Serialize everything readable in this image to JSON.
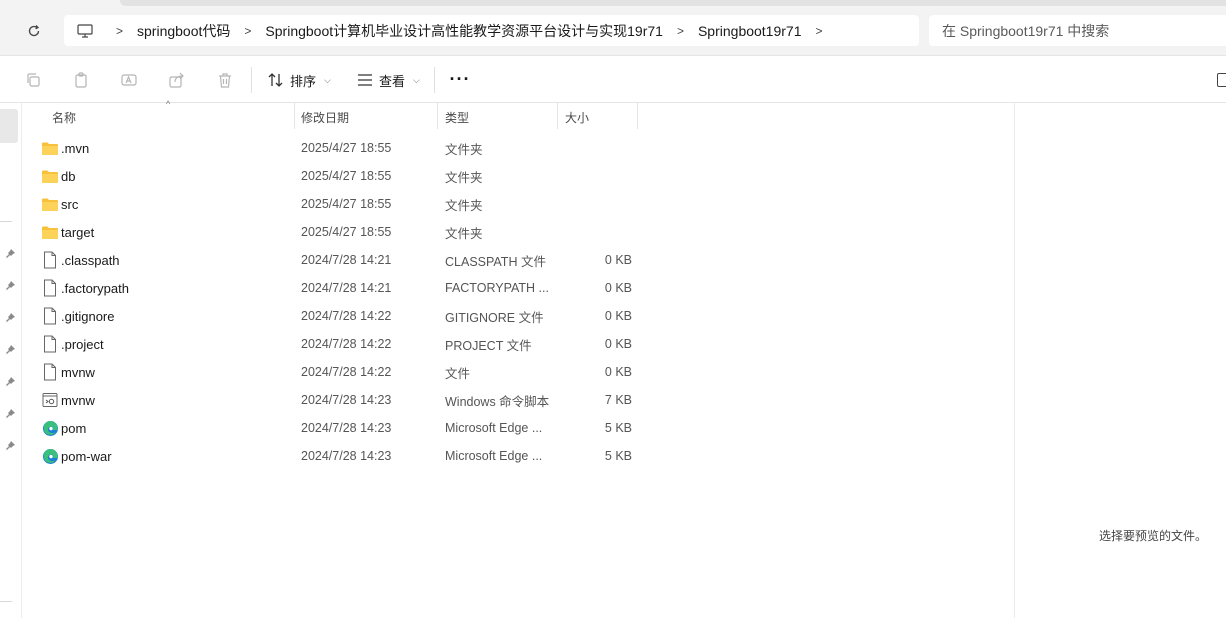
{
  "address_bar": {
    "breadcrumbs": [
      {
        "label": "springboot代码"
      },
      {
        "label": "Springboot计算机毕业设计高性能教学资源平台设计与实现19r71"
      },
      {
        "label": "Springboot19r71"
      }
    ]
  },
  "search": {
    "placeholder": "在 Springboot19r71 中搜索"
  },
  "toolbar": {
    "sort_label": "排序",
    "view_label": "查看",
    "more_label": "···"
  },
  "columns": {
    "name": "名称",
    "date": "修改日期",
    "type": "类型",
    "size": "大小"
  },
  "files": [
    {
      "icon": "folder-icon",
      "name": ".mvn",
      "date": "2025/4/27 18:55",
      "type": "文件夹",
      "size": ""
    },
    {
      "icon": "folder-icon",
      "name": "db",
      "date": "2025/4/27 18:55",
      "type": "文件夹",
      "size": ""
    },
    {
      "icon": "folder-icon",
      "name": "src",
      "date": "2025/4/27 18:55",
      "type": "文件夹",
      "size": ""
    },
    {
      "icon": "folder-icon",
      "name": "target",
      "date": "2025/4/27 18:55",
      "type": "文件夹",
      "size": ""
    },
    {
      "icon": "file-icon",
      "name": ".classpath",
      "date": "2024/7/28 14:21",
      "type": "CLASSPATH 文件",
      "size": "0 KB"
    },
    {
      "icon": "file-icon",
      "name": ".factorypath",
      "date": "2024/7/28 14:21",
      "type": "FACTORYPATH ...",
      "size": "0 KB"
    },
    {
      "icon": "file-icon",
      "name": ".gitignore",
      "date": "2024/7/28 14:22",
      "type": "GITIGNORE 文件",
      "size": "0 KB"
    },
    {
      "icon": "file-icon",
      "name": ".project",
      "date": "2024/7/28 14:22",
      "type": "PROJECT 文件",
      "size": "0 KB"
    },
    {
      "icon": "file-icon",
      "name": "mvnw",
      "date": "2024/7/28 14:22",
      "type": "文件",
      "size": "0 KB"
    },
    {
      "icon": "script-icon",
      "name": "mvnw",
      "date": "2024/7/28 14:23",
      "type": "Windows 命令脚本",
      "size": "7 KB"
    },
    {
      "icon": "edge-icon",
      "name": "pom",
      "date": "2024/7/28 14:23",
      "type": "Microsoft Edge ...",
      "size": "5 KB"
    },
    {
      "icon": "edge-icon",
      "name": "pom-war",
      "date": "2024/7/28 14:23",
      "type": "Microsoft Edge ...",
      "size": "5 KB"
    }
  ],
  "preview": {
    "message": "选择要预览的文件。"
  },
  "colors": {
    "folder": "#f8c13c",
    "edge_blue": "#1b7fd6",
    "edge_green": "#39c07a"
  }
}
